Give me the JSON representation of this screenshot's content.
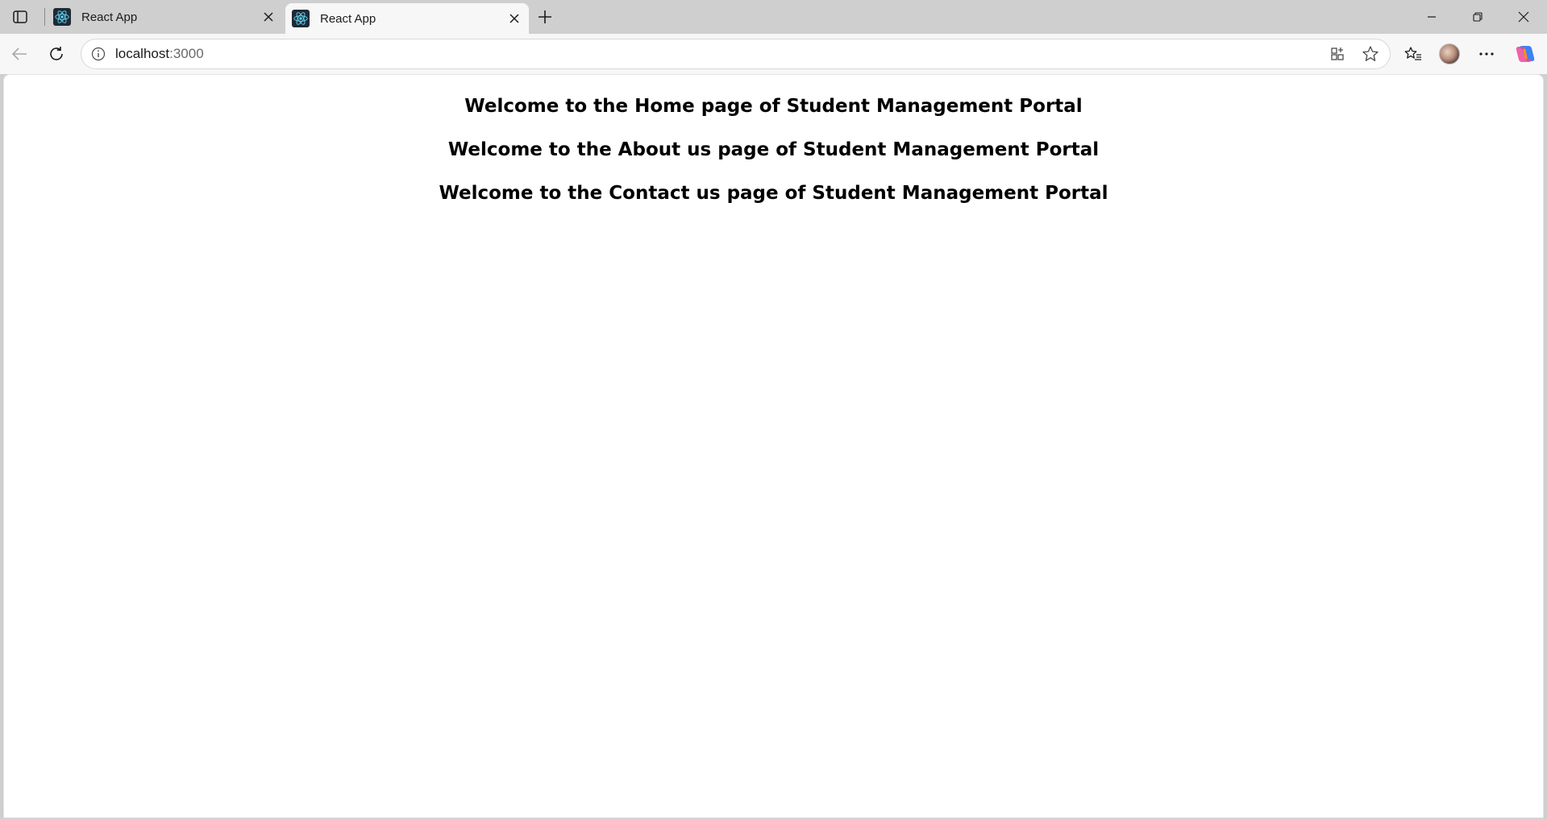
{
  "browser": {
    "tabs": [
      {
        "title": "React App",
        "icon": "react-icon",
        "active": false
      },
      {
        "title": "React App",
        "icon": "react-icon",
        "active": true
      }
    ],
    "address": {
      "host": "localhost",
      "port": ":3000"
    },
    "icons": {
      "tab_actions": "tab-actions-icon",
      "new_tab": "plus-icon",
      "back": "arrow-left-icon",
      "reload": "reload-icon",
      "site_info": "info-icon",
      "split_screen": "split-screen-icon",
      "favorite": "star-icon",
      "favorites": "favorites-list-icon",
      "profile": "avatar",
      "more": "ellipsis-icon",
      "copilot": "copilot-icon",
      "minimize": "minimize-icon",
      "maximize": "restore-icon",
      "close": "close-icon"
    }
  },
  "page": {
    "headings": [
      "Welcome to the Home page of Student Management Portal",
      "Welcome to the About us page of Student Management Portal",
      "Welcome to the Contact us page of Student Management Portal"
    ]
  },
  "colors": {
    "chrome_bg": "#cfcfcf",
    "toolbar_bg": "#f7f7f7",
    "page_bg": "#ffffff",
    "heading_text": "#000000",
    "react_blue": "#61dafb"
  }
}
